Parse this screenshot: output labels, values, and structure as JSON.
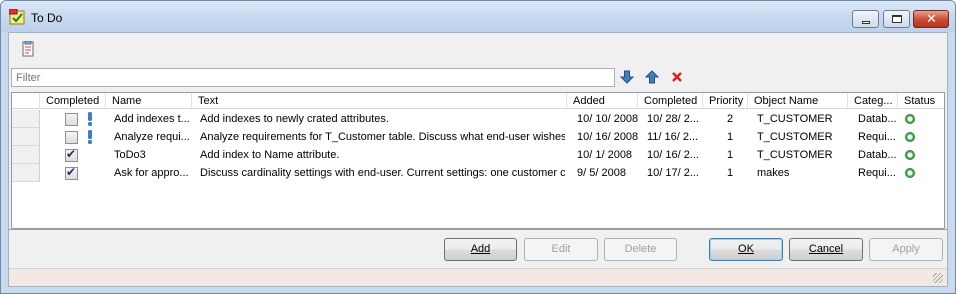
{
  "window": {
    "title": "To Do"
  },
  "filter": {
    "placeholder": "Filter"
  },
  "grid": {
    "columns": [
      "Completed",
      "Name",
      "Text",
      "Added",
      "Completed",
      "Priority",
      "Object Name",
      "Categ...",
      "Status"
    ],
    "rows": [
      {
        "completed": false,
        "name": "Add indexes t...",
        "text": "Add indexes to newly crated attributes.",
        "added": "10/ 10/ 2008",
        "completed_date": "10/ 28/ 2...",
        "priority": "2",
        "object_name": "T_CUSTOMER",
        "category": "Datab...",
        "status": "active"
      },
      {
        "completed": false,
        "name": "Analyze requi...",
        "text": "Analyze requirements for T_Customer table. Discuss what end-user wishes t...",
        "added": "10/ 16/ 2008",
        "completed_date": "11/ 16/ 2...",
        "priority": "1",
        "object_name": "T_CUSTOMER",
        "category": "Requi...",
        "status": "active"
      },
      {
        "completed": true,
        "name": "ToDo3",
        "text": "Add index to Name attribute.",
        "added": "10/ 1/ 2008",
        "completed_date": "10/ 16/ 2...",
        "priority": "1",
        "object_name": "T_CUSTOMER",
        "category": "Datab...",
        "status": "active"
      },
      {
        "completed": true,
        "name": "Ask for appro...",
        "text": "Discuss cardinality settings with end-user. Current settings: one customer ca...",
        "added": "9/ 5/ 2008",
        "completed_date": "10/ 17/ 2...",
        "priority": "1",
        "object_name": "makes",
        "category": "Requi...",
        "status": "active"
      }
    ]
  },
  "buttons": {
    "add": "Add",
    "edit": "Edit",
    "delete": "Delete",
    "ok": "OK",
    "cancel": "Cancel",
    "apply": "Apply"
  },
  "colors": {
    "title_bar": "#c6d8ee",
    "status_green": "#39b54a",
    "priority_icon": "#3f7fc0",
    "delete_icon": "#d62020"
  }
}
